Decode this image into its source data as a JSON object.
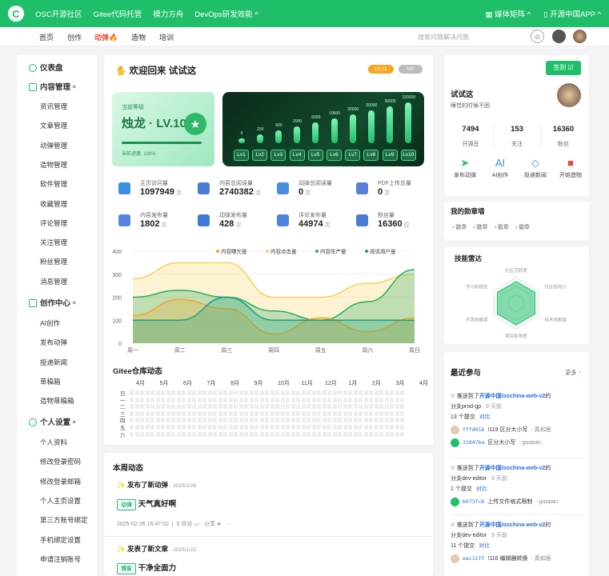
{
  "topbar": {
    "items": [
      "OSC开源社区",
      "Gitee代码托管",
      "模力方舟",
      "DevOps研发效能 ^"
    ],
    "right": [
      "媒体矩阵 ^",
      "开源中国APP ^"
    ]
  },
  "nav": {
    "items": [
      "首页",
      "创作",
      "动弹",
      "造物",
      "培训"
    ],
    "search_placeholder": "搜索问题解决问题"
  },
  "sidebar": {
    "dashboard": "仪表盘",
    "content_mgmt": "内容管理",
    "content_items": [
      "资讯管理",
      "文章管理",
      "动弹管理",
      "造物管理",
      "软件管理",
      "收藏管理",
      "评论管理",
      "关注管理",
      "粉丝管理",
      "消息管理"
    ],
    "creation_center": "创作中心",
    "creation_items": [
      "AI创作",
      "发布动弹",
      "投递新闻",
      "草稿箱",
      "造物草稿箱"
    ],
    "personal": "个人设置",
    "personal_items": [
      "个人资料",
      "修改登录密码",
      "修改登录邮箱",
      "个人主页设置",
      "第三方账号绑定",
      "手机绑定设置",
      "申请注销账号"
    ]
  },
  "welcome": {
    "title": "欢迎回来 试试这",
    "badge1": "LV.11",
    "badge2": "VIP"
  },
  "level": {
    "current_label": "当前等级",
    "name": "烛龙 · LV.10",
    "progress_text": "当前进度: 100%",
    "progress": 1.0,
    "levels": [
      "Lv1",
      "Lv2",
      "Lv3",
      "Lv4",
      "Lv5",
      "Lv6",
      "Lv7",
      "Lv8",
      "Lv9",
      "Lv10"
    ],
    "thresholds": [
      "0",
      "200",
      "600",
      "2000",
      "5000",
      "10000",
      "20000",
      "50000",
      "90000",
      "150000"
    ]
  },
  "stats": [
    {
      "label": "主页访问量",
      "value": "1097949",
      "unit": "次"
    },
    {
      "label": "内容总阅读量",
      "value": "2740382",
      "unit": "次"
    },
    {
      "label": "动弹总阅读量",
      "value": "0",
      "unit": "次"
    },
    {
      "label": "PDF上传总量",
      "value": "0",
      "unit": "次"
    },
    {
      "label": "内容发布量",
      "value": "1802",
      "unit": "次"
    },
    {
      "label": "动弹发布量",
      "value": "428",
      "unit": "次"
    },
    {
      "label": "评论发布量",
      "value": "44974",
      "unit": "次"
    },
    {
      "label": "粉丝量",
      "value": "16360",
      "unit": "位"
    }
  ],
  "chart_data": {
    "type": "area",
    "categories": [
      "周一",
      "周二",
      "周三",
      "周四",
      "周五",
      "周六",
      "周日"
    ],
    "ylim": [
      0,
      400
    ],
    "yticks": [
      "0",
      "100",
      "200",
      "300",
      "400"
    ],
    "series": [
      {
        "name": "内容曝光量",
        "color": "#f5a623",
        "values": [
          120,
          190,
          150,
          40,
          110,
          50,
          110
        ]
      },
      {
        "name": "内容点击量",
        "color": "#f7d25a",
        "values": [
          280,
          350,
          350,
          200,
          200,
          260,
          300
        ]
      },
      {
        "name": "内容生产量",
        "color": "#27ae60",
        "values": [
          200,
          230,
          200,
          140,
          100,
          180,
          320
        ]
      },
      {
        "name": "阅读用户量",
        "color": "#16a085",
        "values": [
          100,
          100,
          200,
          100,
          100,
          100,
          100
        ]
      }
    ]
  },
  "gitee": {
    "title": "Gitee仓库动态",
    "months": [
      "4月",
      "5月",
      "6月",
      "7月",
      "8月",
      "9月",
      "10月",
      "11月",
      "12月",
      "1月",
      "2月",
      "3月",
      "4月"
    ],
    "days": [
      "日",
      "一",
      "二",
      "三",
      "四",
      "五",
      "六"
    ]
  },
  "week": {
    "title": "本周动态",
    "items": [
      {
        "action": "发布了新动弹",
        "date": "- 2025/2/26",
        "tag": "动弹",
        "title": "天气真好啊",
        "time": "2025-02-26 16:47:02",
        "comments": "0 评论",
        "share": "分享",
        "more": "···"
      },
      {
        "action": "发表了新文章",
        "date": "- 2025/1/22",
        "tag": "博客",
        "title": "干净全面力"
      }
    ]
  },
  "profile": {
    "checkin": "签到",
    "name": "试试这",
    "bio": "睡觉的时候不困",
    "counts": [
      {
        "v": "7494",
        "l": "开源豆"
      },
      {
        "v": "153",
        "l": "关注"
      },
      {
        "v": "16360",
        "l": "粉丝"
      }
    ],
    "actions": [
      "发布动弹",
      "AI创作",
      "投递新闻",
      "开始造物"
    ]
  },
  "medals": {
    "title": "我的勋章墙",
    "items": [
      "徽章",
      "徽章",
      "徽章",
      "徽章"
    ]
  },
  "radar": {
    "title": "技能雷达",
    "axes": [
      "社区活跃度",
      "社区影响力",
      "技术贡献度",
      "项目影响度",
      "开源贡献度",
      "学习积极性"
    ]
  },
  "recent": {
    "title": "最近参与",
    "more": "更多",
    "items": [
      {
        "prefix": "推送到了",
        "repo": "开源中国/oschina-web-v2",
        "suffix": "的",
        "branch": "分支prod-gp",
        "ago": "9 天前",
        "commits": "13 个提交",
        "cmp": "对比",
        "lines": [
          {
            "sha": "fffd01b",
            "msg": "!119 区分大小写",
            "author": "- 真如居"
          },
          {
            "sha": "32847ba",
            "msg": "区分大小写",
            "author": "- guopan"
          }
        ]
      },
      {
        "prefix": "推送到了",
        "repo": "开源中国/oschina-web-v2",
        "suffix": "的",
        "branch": "分支dev-editor",
        "ago": "9 天前",
        "commits": "1 个提交",
        "cmp": "对比",
        "lines": [
          {
            "sha": "b073fcb",
            "msg": "上传文件格式限制",
            "author": "- guopan"
          }
        ]
      },
      {
        "prefix": "推送到了",
        "repo": "开源中国/oschina-web-v2",
        "suffix": "的",
        "branch": "分支dev-editor",
        "ago": "9 天前",
        "commits": "11 个提交",
        "cmp": "对比",
        "lines": [
          {
            "sha": "eac11ff",
            "msg": "!116 编辑器转换",
            "author": "- 真如居"
          }
        ]
      }
    ]
  }
}
